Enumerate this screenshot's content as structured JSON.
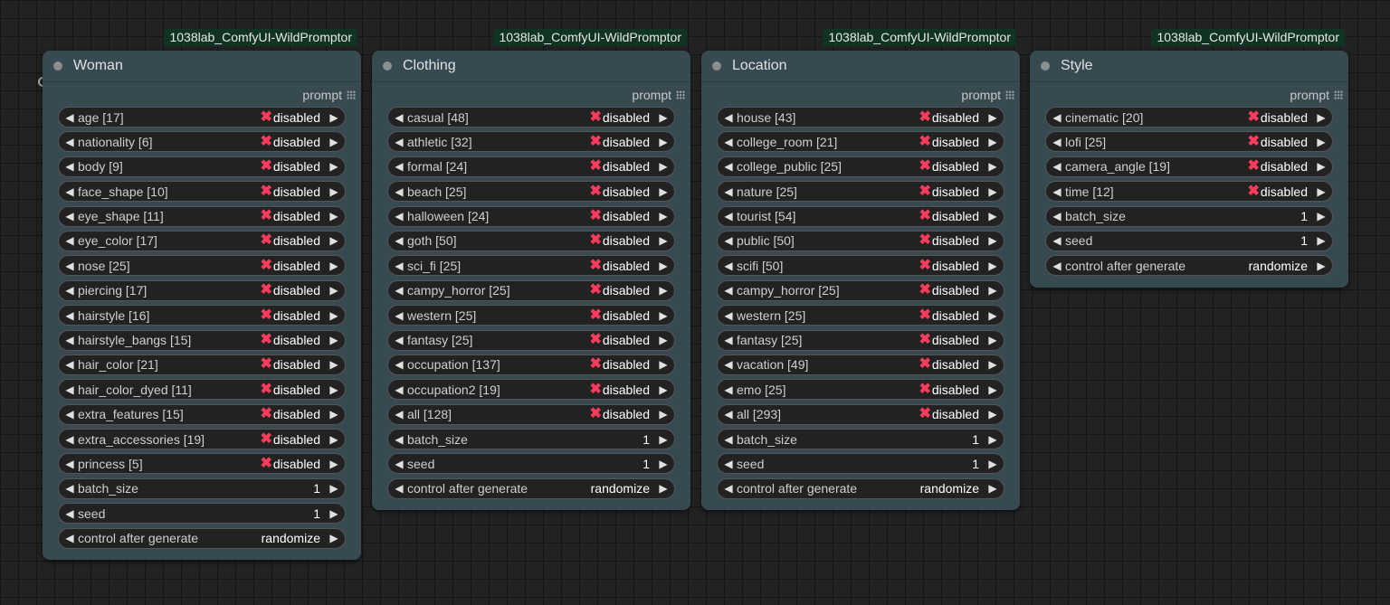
{
  "badge_text": "1038lab_ComfyUI-WildPromptor",
  "output_label": "prompt",
  "disabled_label": "disabled",
  "disabled_icon": "x-mark-icon",
  "nodes": [
    {
      "title": "Woman",
      "fields": [
        {
          "label": "age [17]",
          "value": "disabled",
          "disabled": true
        },
        {
          "label": "nationality [6]",
          "value": "disabled",
          "disabled": true
        },
        {
          "label": "body [9]",
          "value": "disabled",
          "disabled": true
        },
        {
          "label": "face_shape [10]",
          "value": "disabled",
          "disabled": true
        },
        {
          "label": "eye_shape [11]",
          "value": "disabled",
          "disabled": true
        },
        {
          "label": "eye_color [17]",
          "value": "disabled",
          "disabled": true
        },
        {
          "label": "nose [25]",
          "value": "disabled",
          "disabled": true
        },
        {
          "label": "piercing [17]",
          "value": "disabled",
          "disabled": true
        },
        {
          "label": "hairstyle [16]",
          "value": "disabled",
          "disabled": true
        },
        {
          "label": "hairstyle_bangs [15]",
          "value": "disabled",
          "disabled": true
        },
        {
          "label": "hair_color [21]",
          "value": "disabled",
          "disabled": true
        },
        {
          "label": "hair_color_dyed [11]",
          "value": "disabled",
          "disabled": true
        },
        {
          "label": "extra_features [15]",
          "value": "disabled",
          "disabled": true
        },
        {
          "label": "extra_accessories [19]",
          "value": "disabled",
          "disabled": true
        },
        {
          "label": "princess [5]",
          "value": "disabled",
          "disabled": true
        },
        {
          "label": "batch_size",
          "value": "1",
          "disabled": false
        },
        {
          "label": "seed",
          "value": "1",
          "disabled": false
        },
        {
          "label": "control after generate",
          "value": "randomize",
          "disabled": false
        }
      ]
    },
    {
      "title": "Clothing",
      "fields": [
        {
          "label": "casual [48]",
          "value": "disabled",
          "disabled": true
        },
        {
          "label": "athletic [32]",
          "value": "disabled",
          "disabled": true
        },
        {
          "label": "formal [24]",
          "value": "disabled",
          "disabled": true
        },
        {
          "label": "beach [25]",
          "value": "disabled",
          "disabled": true
        },
        {
          "label": "halloween [24]",
          "value": "disabled",
          "disabled": true
        },
        {
          "label": "goth [50]",
          "value": "disabled",
          "disabled": true
        },
        {
          "label": "sci_fi [25]",
          "value": "disabled",
          "disabled": true
        },
        {
          "label": "campy_horror [25]",
          "value": "disabled",
          "disabled": true
        },
        {
          "label": "western [25]",
          "value": "disabled",
          "disabled": true
        },
        {
          "label": "fantasy [25]",
          "value": "disabled",
          "disabled": true
        },
        {
          "label": "occupation [137]",
          "value": "disabled",
          "disabled": true
        },
        {
          "label": "occupation2 [19]",
          "value": "disabled",
          "disabled": true
        },
        {
          "label": "all [128]",
          "value": "disabled",
          "disabled": true
        },
        {
          "label": "batch_size",
          "value": "1",
          "disabled": false
        },
        {
          "label": "seed",
          "value": "1",
          "disabled": false
        },
        {
          "label": "control after generate",
          "value": "randomize",
          "disabled": false
        }
      ]
    },
    {
      "title": "Location",
      "fields": [
        {
          "label": "house [43]",
          "value": "disabled",
          "disabled": true
        },
        {
          "label": "college_room [21]",
          "value": "disabled",
          "disabled": true
        },
        {
          "label": "college_public [25]",
          "value": "disabled",
          "disabled": true
        },
        {
          "label": "nature [25]",
          "value": "disabled",
          "disabled": true
        },
        {
          "label": "tourist [54]",
          "value": "disabled",
          "disabled": true
        },
        {
          "label": "public [50]",
          "value": "disabled",
          "disabled": true
        },
        {
          "label": "scifi [50]",
          "value": "disabled",
          "disabled": true
        },
        {
          "label": "campy_horror [25]",
          "value": "disabled",
          "disabled": true
        },
        {
          "label": "western [25]",
          "value": "disabled",
          "disabled": true
        },
        {
          "label": "fantasy [25]",
          "value": "disabled",
          "disabled": true
        },
        {
          "label": "vacation [49]",
          "value": "disabled",
          "disabled": true
        },
        {
          "label": "emo [25]",
          "value": "disabled",
          "disabled": true
        },
        {
          "label": "all [293]",
          "value": "disabled",
          "disabled": true
        },
        {
          "label": "batch_size",
          "value": "1",
          "disabled": false
        },
        {
          "label": "seed",
          "value": "1",
          "disabled": false
        },
        {
          "label": "control after generate",
          "value": "randomize",
          "disabled": false
        }
      ]
    },
    {
      "title": "Style",
      "fields": [
        {
          "label": "cinematic [20]",
          "value": "disabled",
          "disabled": true
        },
        {
          "label": "lofi [25]",
          "value": "disabled",
          "disabled": true
        },
        {
          "label": "camera_angle [19]",
          "value": "disabled",
          "disabled": true
        },
        {
          "label": "time [12]",
          "value": "disabled",
          "disabled": true
        },
        {
          "label": "batch_size",
          "value": "1",
          "disabled": false
        },
        {
          "label": "seed",
          "value": "1",
          "disabled": false
        },
        {
          "label": "control after generate",
          "value": "randomize",
          "disabled": false
        }
      ]
    }
  ]
}
